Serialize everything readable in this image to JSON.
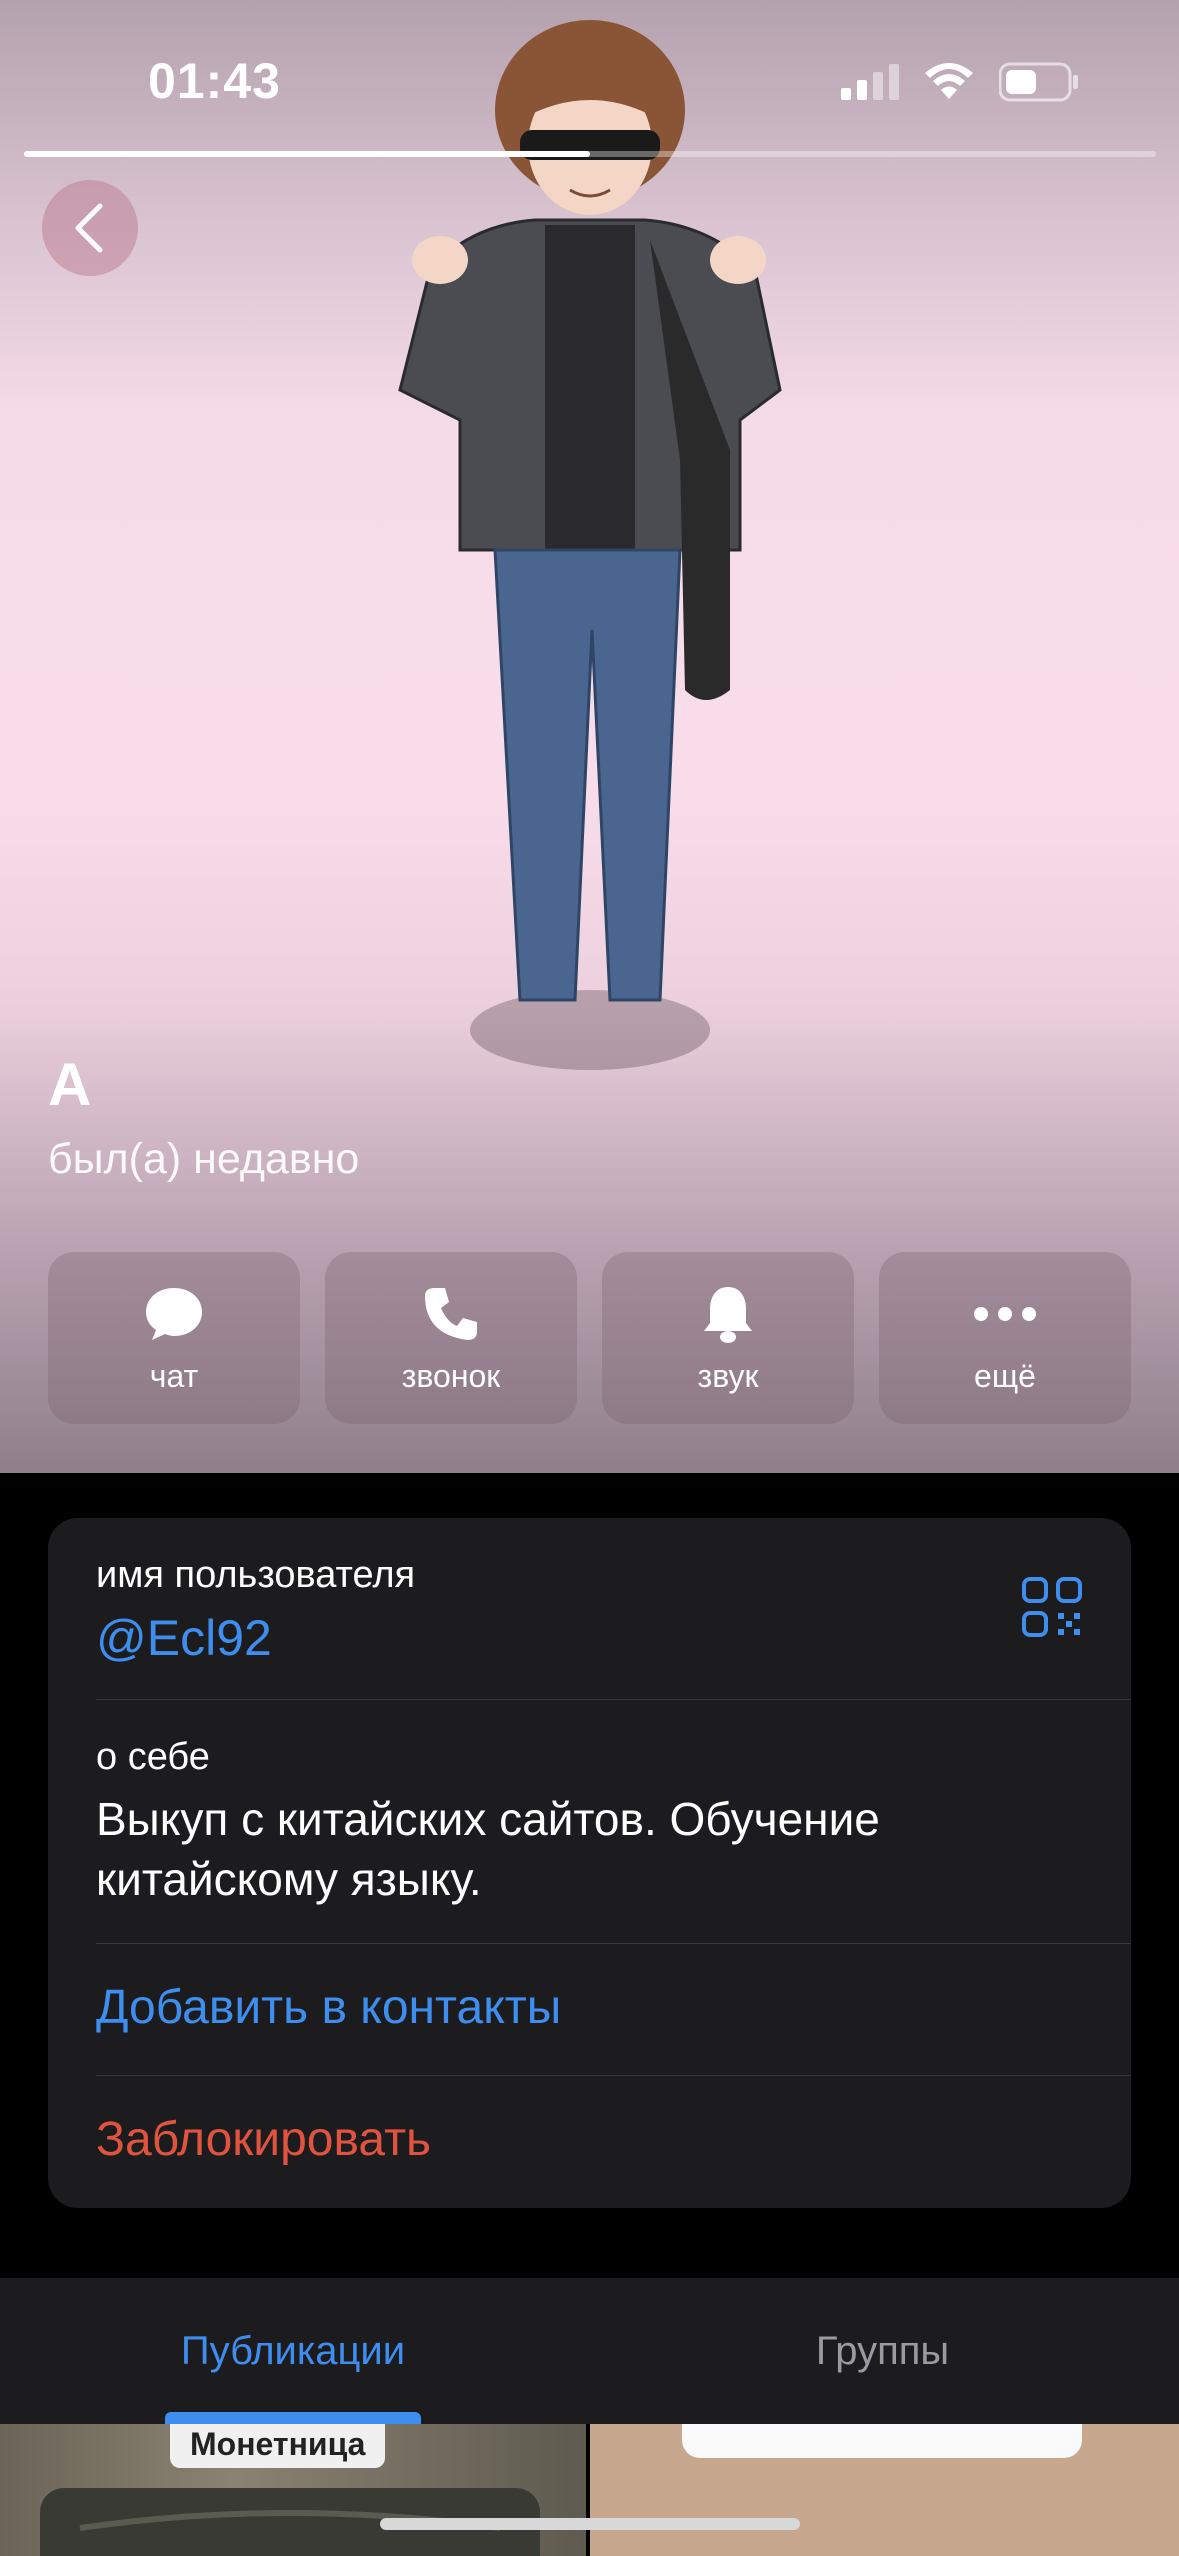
{
  "status_bar": {
    "time": "01:43"
  },
  "story": {
    "progress": 0.5
  },
  "profile": {
    "name": "А",
    "status": "был(а) недавно"
  },
  "actions": [
    {
      "label": "чат",
      "icon": "chat-bubble-icon"
    },
    {
      "label": "звонок",
      "icon": "phone-icon"
    },
    {
      "label": "звук",
      "icon": "bell-icon"
    },
    {
      "label": "ещё",
      "icon": "more-dots-icon"
    }
  ],
  "info": {
    "username_label": "имя пользователя",
    "username": "@Ecl92",
    "about_label": "о себе",
    "about_line1": "Выкуп с китайских сайтов. Обучение",
    "about_line2": "китайскому языку.",
    "add_contact": "Добавить в контакты",
    "block": "Заблокировать"
  },
  "tabs": [
    {
      "label": "Публикации",
      "active": true
    },
    {
      "label": "Группы",
      "active": false
    }
  ],
  "publications": {
    "first_tag": "Монетница"
  },
  "colors": {
    "accent": "#3e8ef0",
    "danger": "#e0533f",
    "card": "#1c1c1e"
  }
}
